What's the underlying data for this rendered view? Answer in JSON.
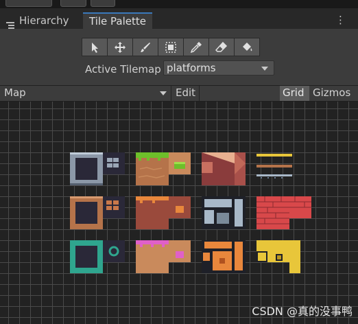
{
  "tabs": [
    {
      "label": "Hierarchy",
      "icon": "list-icon"
    },
    {
      "label": "Tile Palette",
      "icon": ""
    }
  ],
  "tools": [
    "select-icon",
    "move-icon",
    "paint-brush-icon",
    "box-fill-icon",
    "picker-icon",
    "eraser-icon",
    "flood-fill-icon"
  ],
  "active_tilemap": {
    "label": "Active Tilemap",
    "value": "platforms"
  },
  "palette_bar": {
    "palette": "Map",
    "edit": "Edit",
    "grid": "Grid",
    "gizmos": "Gizmos"
  },
  "watermark": "CSDN @真的没事鸭",
  "colors": {
    "accent_blue": "#3a79bb",
    "grass_green": "#6dbf2a",
    "dirt_brown": "#b5734a",
    "brick_red": "#d8484a",
    "gold": "#e8c63a",
    "orange": "#e8873c",
    "teal": "#2fa58e",
    "pink": "#e060c8"
  }
}
